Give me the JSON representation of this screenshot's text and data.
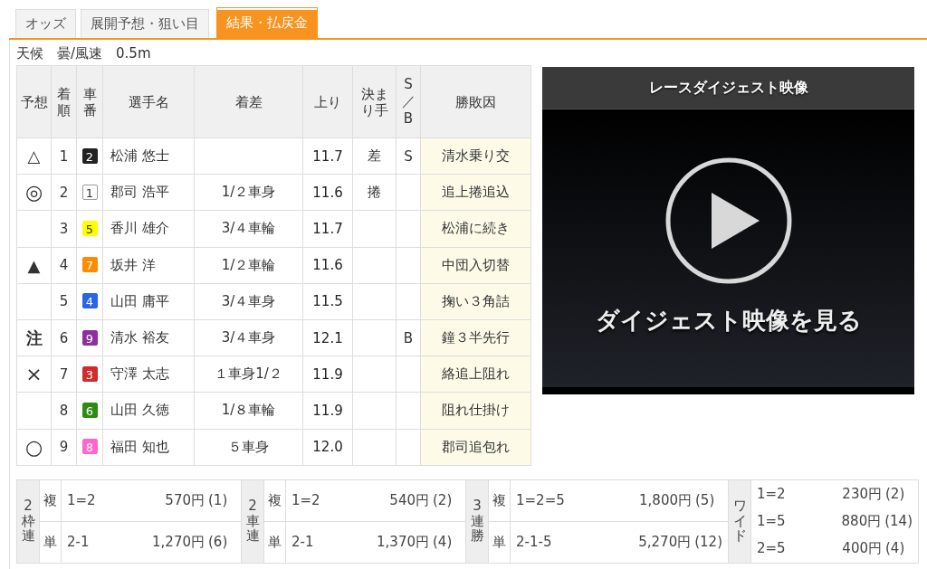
{
  "tabs": [
    {
      "label": "オッズ",
      "selected": false
    },
    {
      "label": "展開予想・狙い目",
      "selected": false
    },
    {
      "label": "結果・払戻金",
      "selected": true
    }
  ],
  "weather": "天候　曇/風速　0.5m",
  "results": {
    "columns": [
      "予想",
      "着順",
      "車番",
      "選手名",
      "着差",
      "上り",
      "決まり手",
      "S／B",
      "勝敗因"
    ],
    "rows": [
      {
        "prediction": "△",
        "rank": "1",
        "car": "2",
        "color": "#222222",
        "name": "松浦 悠士",
        "time": "11.7",
        "technique": "差",
        "sb": "S",
        "factor": "清水乗り交"
      },
      {
        "prediction": "◎",
        "rank": "2",
        "car": "1",
        "color": "#ffffff",
        "name": "郡司 浩平",
        "margin": "1/２車身",
        "time": "11.6",
        "technique": "捲",
        "factor": "追上捲追込"
      },
      {
        "rank": "3",
        "car": "5",
        "color": "#ffff00",
        "name": "香川 雄介",
        "margin": "3/４車輪",
        "time": "11.7",
        "factor": "松浦に続き"
      },
      {
        "prediction": "▲",
        "rank": "4",
        "car": "7",
        "color": "#ff8c00",
        "name": "坂井 洋",
        "margin": "1/２車輪",
        "time": "11.6",
        "factor": "中団入切替"
      },
      {
        "rank": "5",
        "car": "4",
        "color": "#2a62e8",
        "name": "山田 庸平",
        "margin": "3/４車身",
        "time": "11.5",
        "factor": "掬い３角詰"
      },
      {
        "prediction": "注",
        "rank": "6",
        "car": "9",
        "color": "#8e2fa0",
        "name": "清水 裕友",
        "margin": "3/４車身",
        "time": "12.1",
        "sb": "B",
        "factor": "鐘３半先行"
      },
      {
        "prediction": "×",
        "rank": "7",
        "car": "3",
        "color": "#d12b2b",
        "name": "守澤 太志",
        "margin": "１車身1/２",
        "time": "11.9",
        "factor": "絡追上阻れ"
      },
      {
        "rank": "8",
        "car": "6",
        "color": "#2e8b12",
        "name": "山田 久徳",
        "margin": "1/８車輪",
        "time": "11.9",
        "factor": "阻れ仕掛け"
      },
      {
        "prediction": "○",
        "rank": "9",
        "car": "8",
        "color": "#ff66cc",
        "name": "福田 知也",
        "margin": "５車身",
        "time": "12.0",
        "factor": "郡司追包れ"
      }
    ]
  },
  "video": {
    "title": "レースダイジェスト映像",
    "caption": "ダイジェスト映像を見る"
  },
  "payouts": [
    {
      "label": "2枠連",
      "kind": "split",
      "rows": [
        {
          "type": "複",
          "combo": "1=2",
          "payout": "570円",
          "popularity": "(1)"
        },
        {
          "type": "単",
          "combo": "2-1",
          "payout": "1,270円",
          "popularity": "(6)"
        }
      ]
    },
    {
      "label": "2車連",
      "kind": "split",
      "rows": [
        {
          "type": "複",
          "combo": "1=2",
          "payout": "540円",
          "popularity": "(2)"
        },
        {
          "type": "単",
          "combo": "2-1",
          "payout": "1,370円",
          "popularity": "(4)"
        }
      ]
    },
    {
      "label": "3連勝",
      "kind": "split",
      "rows": [
        {
          "type": "複",
          "combo": "1=2=5",
          "payout": "1,800円",
          "popularity": "(5)"
        },
        {
          "type": "単",
          "combo": "2-1-5",
          "payout": "5,270円",
          "popularity": "(12)"
        }
      ]
    },
    {
      "label": "ワイド",
      "kind": "list",
      "rows": [
        {
          "combo": "1=2",
          "payout": "230円",
          "popularity": "(2)"
        },
        {
          "combo": "1=5",
          "payout": "880円",
          "popularity": "(14)"
        },
        {
          "combo": "2=5",
          "payout": "400円",
          "popularity": "(4)"
        }
      ]
    }
  ]
}
